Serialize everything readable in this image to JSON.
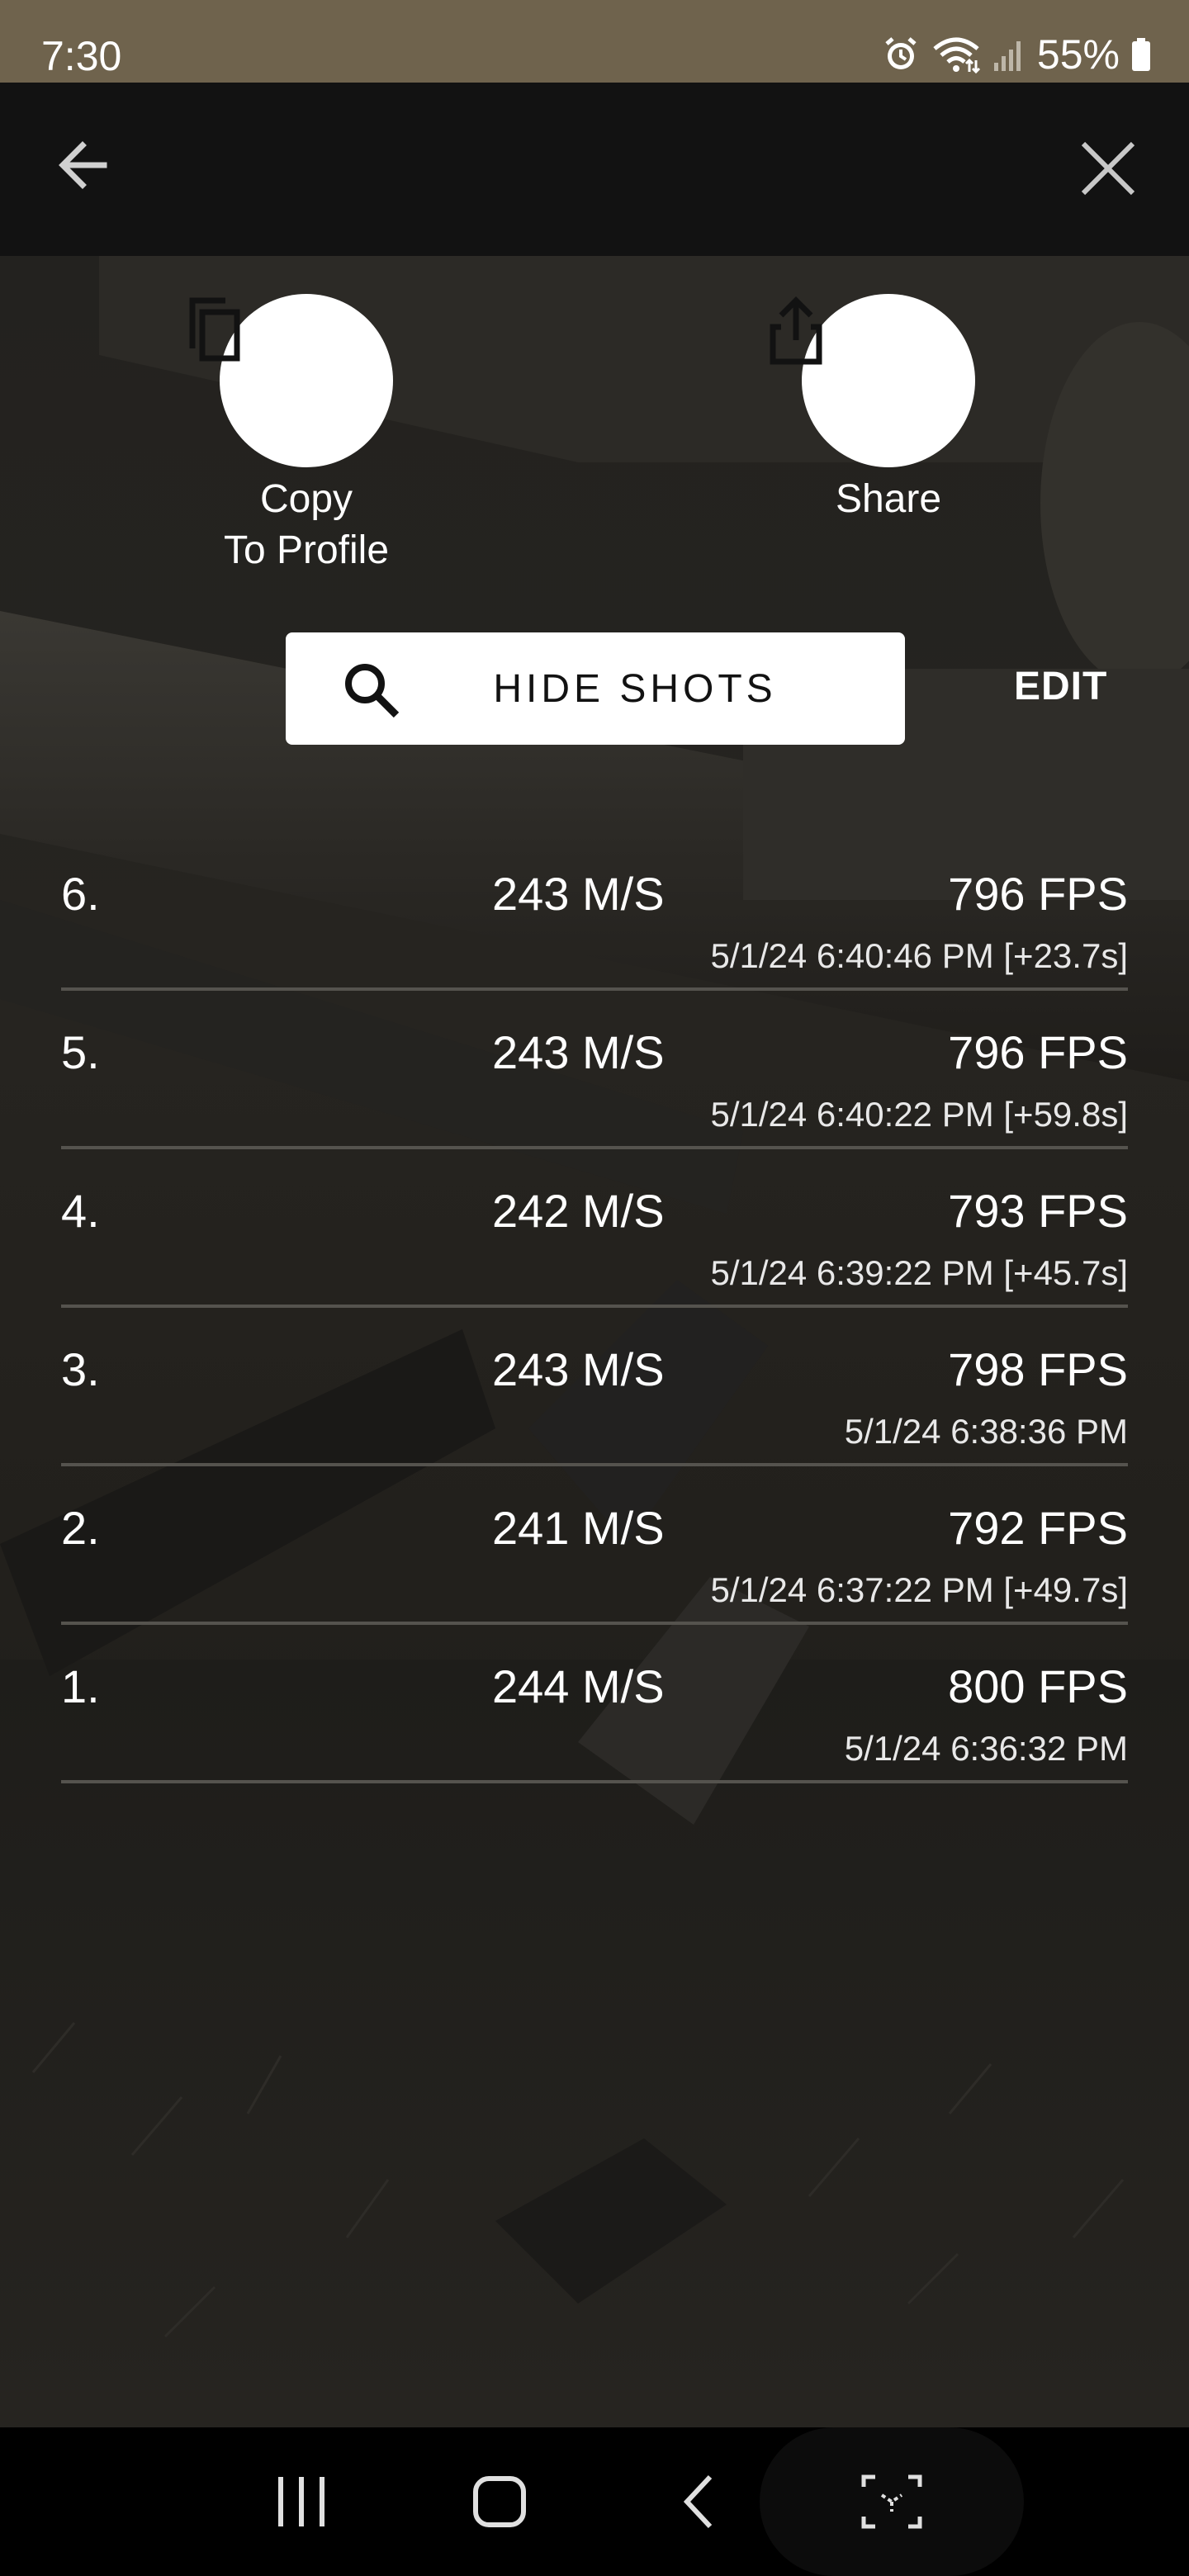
{
  "status_bar": {
    "time": "7:30",
    "battery": "55%",
    "icons": [
      "alarm-icon",
      "wifi-icon",
      "signal-icon",
      "battery-icon"
    ]
  },
  "app_bar": {
    "back_icon": "arrow-left-icon",
    "close_icon": "close-icon"
  },
  "actions": {
    "copy": {
      "label_line1": "Copy",
      "label_line2": "To Profile",
      "icon": "copy-icon"
    },
    "share": {
      "label": "Share",
      "icon": "share-icon"
    }
  },
  "hide_shots": {
    "label": "HIDE SHOTS",
    "icon": "search-icon"
  },
  "edit_label": "EDIT",
  "shots": [
    {
      "number": "6.",
      "ms": "243 M/S",
      "fps": "796 FPS",
      "timestamp": "5/1/24 6:40:46 PM [+23.7s]"
    },
    {
      "number": "5.",
      "ms": "243 M/S",
      "fps": "796 FPS",
      "timestamp": "5/1/24 6:40:22 PM [+59.8s]"
    },
    {
      "number": "4.",
      "ms": "242 M/S",
      "fps": "793 FPS",
      "timestamp": "5/1/24 6:39:22 PM [+45.7s]"
    },
    {
      "number": "3.",
      "ms": "243 M/S",
      "fps": "798 FPS",
      "timestamp": "5/1/24 6:38:36 PM"
    },
    {
      "number": "2.",
      "ms": "241 M/S",
      "fps": "792 FPS",
      "timestamp": "5/1/24 6:37:22 PM [+49.7s]"
    },
    {
      "number": "1.",
      "ms": "244 M/S",
      "fps": "800 FPS",
      "timestamp": "5/1/24 6:36:32 PM"
    }
  ],
  "nav_bar": {
    "icons": [
      "recent-apps-icon",
      "home-icon",
      "back-icon",
      "screenshot-icon"
    ]
  },
  "colors": {
    "status_bar_bg": "#6f634d",
    "app_bar_bg": "#121212",
    "divider": "#55534e"
  }
}
